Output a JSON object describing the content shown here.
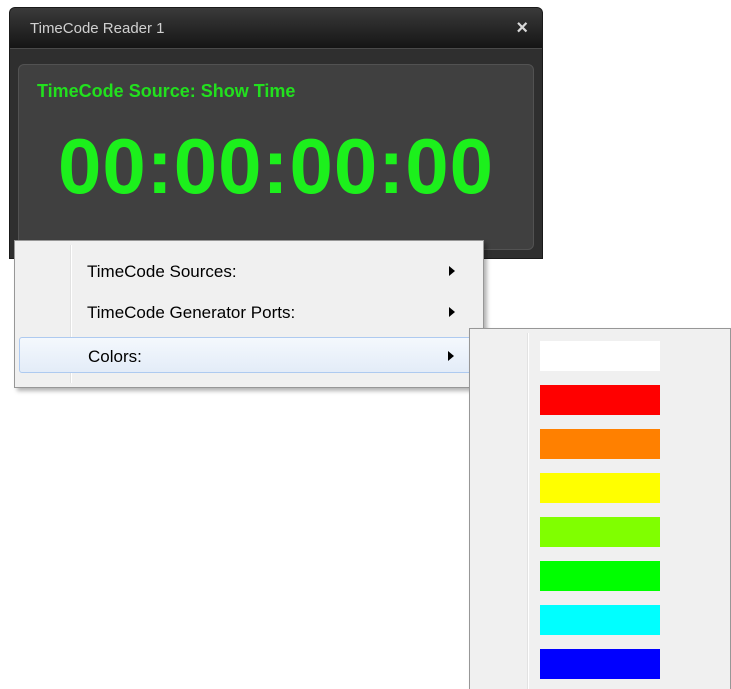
{
  "window": {
    "title": "TimeCode Reader 1",
    "close_glyph": "×",
    "source_text": "TimeCode Source: Show Time",
    "timecode": "00:00:00:00",
    "accent_color": "#1cf01c"
  },
  "context_menu": {
    "items": [
      {
        "label": "TimeCode Sources:",
        "has_submenu": true
      },
      {
        "label": "TimeCode Generator Ports:",
        "has_submenu": true
      },
      {
        "label": "Colors:",
        "has_submenu": true,
        "highlighted": true
      }
    ]
  },
  "colors_submenu": {
    "swatches": [
      "#ffffff",
      "#ff0000",
      "#ff8000",
      "#ffff00",
      "#80ff00",
      "#00ff00",
      "#00ffff",
      "#0000ff"
    ]
  }
}
